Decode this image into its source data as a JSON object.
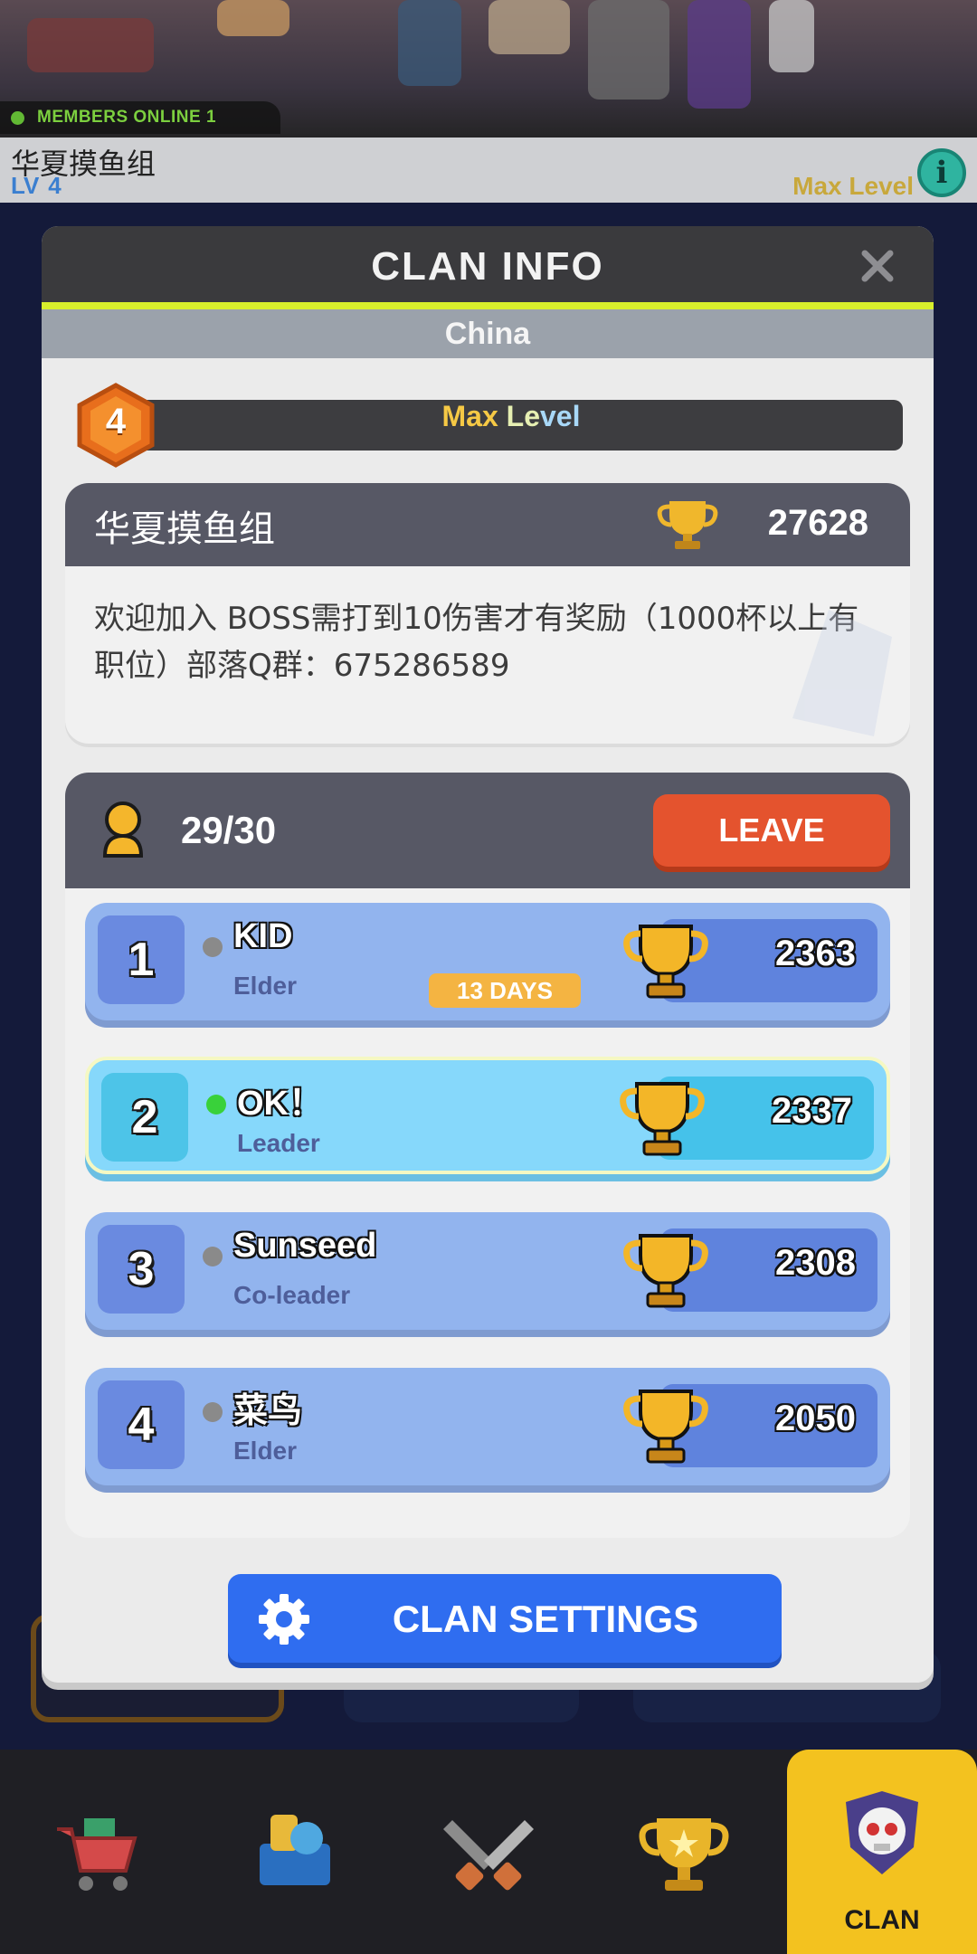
{
  "top": {
    "members_online": "MEMBERS ONLINE 1",
    "clan_name": "华夏摸鱼组",
    "level_prefix": "LV",
    "level_value": "4",
    "max_level": "Max Level"
  },
  "modal": {
    "title": "CLAN INFO",
    "region": "China",
    "level_badge": "4",
    "level_bar": {
      "part1": "Max ",
      "part2": "Le",
      "part3": "vel"
    },
    "clan": {
      "name": "华夏摸鱼组",
      "trophies": "27628",
      "description": "欢迎加入 BOSS需打到10伤害才有奖励（1000杯以上有职位）部落Q群：675286589"
    },
    "members_count": "29/30",
    "leave_label": "LEAVE",
    "members": [
      {
        "rank": "1",
        "name": "KID",
        "role": "Elder",
        "trophies": "2363",
        "online": false,
        "badge": "13 DAYS"
      },
      {
        "rank": "2",
        "name": "OK！",
        "role": "Leader",
        "trophies": "2337",
        "online": true,
        "badge": ""
      },
      {
        "rank": "3",
        "name": "Sunseed",
        "role": "Co-leader",
        "trophies": "2308",
        "online": false,
        "badge": ""
      },
      {
        "rank": "4",
        "name": "菜鸟",
        "role": "Elder",
        "trophies": "2050",
        "online": false,
        "badge": ""
      }
    ],
    "settings_label": "CLAN SETTINGS"
  },
  "nav": {
    "items": [
      {
        "icon": "shop-cart-icon",
        "label": ""
      },
      {
        "icon": "cards-icon",
        "label": ""
      },
      {
        "icon": "battle-swords-icon",
        "label": ""
      },
      {
        "icon": "trophy-icon",
        "label": ""
      },
      {
        "icon": "clan-skull-icon",
        "label": "CLAN"
      }
    ]
  },
  "colors": {
    "accent_yellow": "#d8ef2c",
    "leave_red": "#e4532e",
    "settings_blue": "#2f6df0",
    "member_blue": "#92b4ee",
    "me_cyan": "#86d8fb",
    "nav_active": "#f3c21f"
  }
}
